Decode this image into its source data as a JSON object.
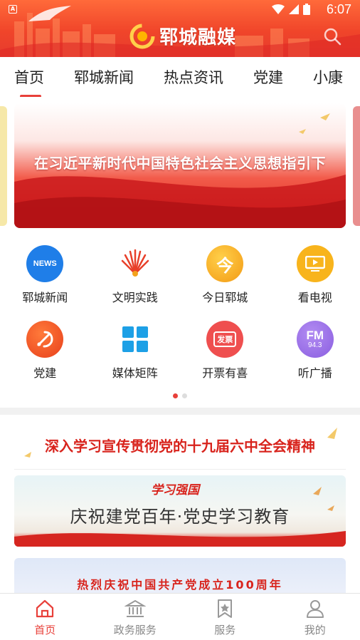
{
  "status_bar": {
    "time": "6:07",
    "app_badge": "A"
  },
  "header": {
    "brand": "郓城融媒"
  },
  "tabs": [
    {
      "label": "首页",
      "active": true
    },
    {
      "label": "郓城新闻",
      "active": false
    },
    {
      "label": "热点资讯",
      "active": false
    },
    {
      "label": "党建",
      "active": false
    },
    {
      "label": "小康",
      "active": false
    }
  ],
  "banner": {
    "text": "在习近平新时代中国特色社会主义思想指引下"
  },
  "grid": [
    {
      "label": "郓城新闻",
      "icon": "news-icon",
      "color": "#1f7ee8",
      "badge": "NEWS"
    },
    {
      "label": "文明实践",
      "icon": "fan-icon",
      "color": "#ffffff",
      "badge": ""
    },
    {
      "label": "今日郓城",
      "icon": "today-icon",
      "color": "#f7a21c",
      "badge": "今"
    },
    {
      "label": "看电视",
      "icon": "tv-icon",
      "color": "#f8b41c",
      "badge": ""
    },
    {
      "label": "党建",
      "icon": "party-icon",
      "color": "#f0552a",
      "badge": ""
    },
    {
      "label": "媒体矩阵",
      "icon": "matrix-icon",
      "color": "#ffffff",
      "badge": ""
    },
    {
      "label": "开票有喜",
      "icon": "ticket-icon",
      "color": "#ef4f4f",
      "badge": "发票"
    },
    {
      "label": "听广播",
      "icon": "fm-icon",
      "color": "#9a6ee6",
      "badge": "FM",
      "freq": "94.3"
    }
  ],
  "promo": {
    "slogan": "深入学习宣传贯彻党的十九届六中全会精神",
    "card2_brand": "学习强国",
    "card2_main": "庆祝建党百年·党史学习教育",
    "card3_text": "热烈庆祝中国共产党成立100周年"
  },
  "bottom_nav": [
    {
      "label": "首页",
      "icon": "home-icon",
      "active": true
    },
    {
      "label": "政务服务",
      "icon": "government-icon",
      "active": false
    },
    {
      "label": "服务",
      "icon": "bookmark-star-icon",
      "active": false
    },
    {
      "label": "我的",
      "icon": "user-icon",
      "active": false
    }
  ],
  "colors": {
    "accent": "#e8403a",
    "header": "#f0452a"
  }
}
